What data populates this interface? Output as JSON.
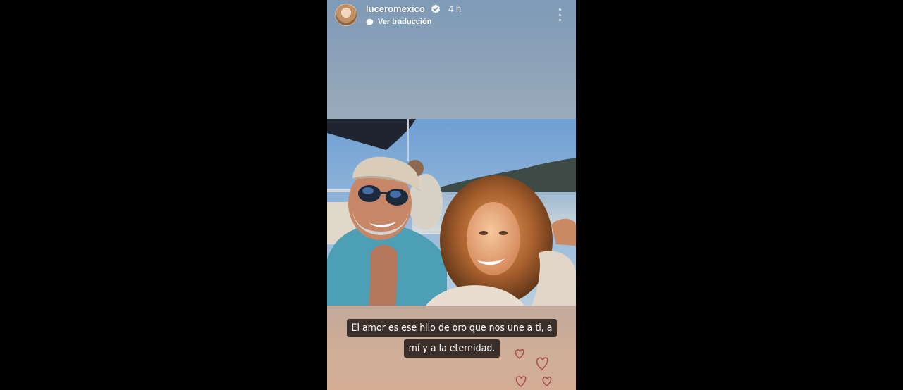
{
  "story": {
    "username": "luceromexico",
    "time_ago": "4 h",
    "translate_label": "Ver traducción",
    "caption": "El amor es ese hilo de oro que nos une a ti, a mí y a la eternidad."
  },
  "icons": {
    "verified": "verified-badge-icon",
    "translate": "translate-bubble-icon",
    "menu": "more-options-icon",
    "stickers": "heart-stickers"
  },
  "colors": {
    "background": "#000000",
    "caption_bg": "#3b3029",
    "verified": "#3897f0",
    "heart": "#a8524f"
  }
}
